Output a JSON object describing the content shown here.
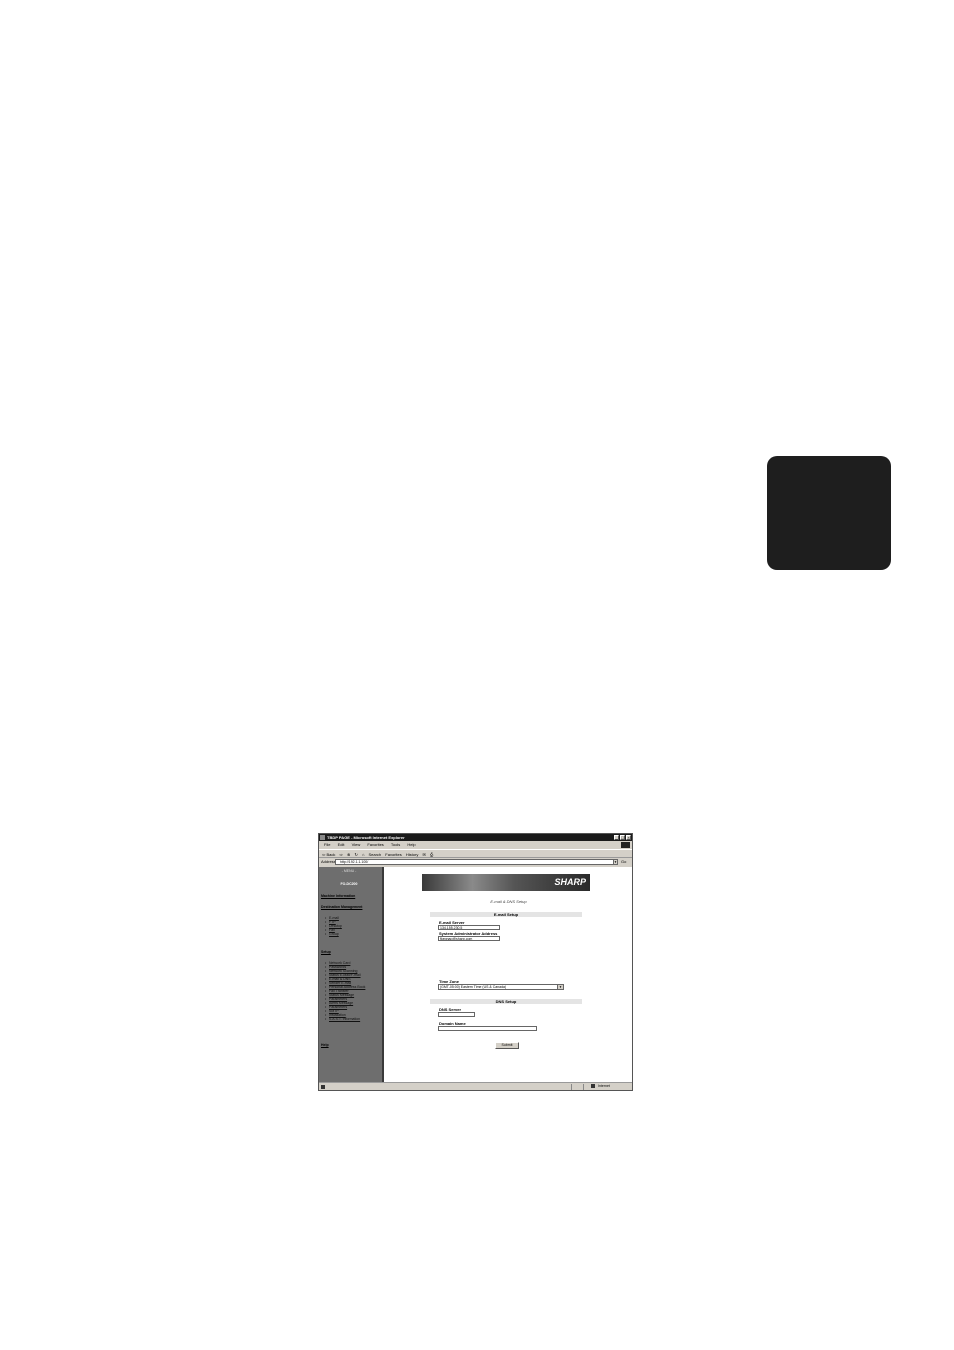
{
  "window": {
    "title": "TBDP PAGE - Microsoft Internet Explorer",
    "controls": [
      "_",
      "□",
      "×"
    ]
  },
  "menubar": {
    "items": [
      "File",
      "Edit",
      "View",
      "Favorites",
      "Tools",
      "Help"
    ]
  },
  "toolbar": {
    "back": "⇦ Back",
    "forward": "⇨",
    "stop": "⊗",
    "refresh": "↻",
    "home": "⌂",
    "search": "Search",
    "favorites": "Favorites",
    "history": "History",
    "mail": "✉",
    "print": "⎙"
  },
  "addressbar": {
    "label": "Address",
    "url": "http://192.1.1.100/",
    "go": "Go"
  },
  "sidebar": {
    "menu_title": "- MENU -",
    "model": "FO-DC200",
    "machine_information": "Machine Information",
    "destination_management": "Destination Management",
    "destination_items": [
      "E-mail",
      "FTP",
      "Desktop",
      "Fax",
      "Group"
    ],
    "setup": "Setup",
    "setup_items": [
      "Network Card",
      "Passwords",
      "Network Scanning",
      "Status E-Mail/F-mail",
      "E-mail & DNS",
      "Sender E-mail",
      "Personal Address Book",
      "Fax Transfer",
      "Status Message",
      "Parameters",
      "Alerts Message",
      "Parameters",
      "SMTP",
      "Installation",
      "S.A.S.T. Information"
    ],
    "help": "Help"
  },
  "main": {
    "banner_logo": "SHARP",
    "page_title": "E-mail & DNS Setup",
    "email_section": "E-mail Setup",
    "email_server_label": "E-mail Server",
    "email_server_value": "134.155.230.5",
    "admin_address_label": "System Administrator Address",
    "admin_address_value": "fkegnap@sharp.com",
    "time_zone_label": "Time Zone",
    "time_zone_value": "(GMT-05:00) Eastern Time (US & Canada)",
    "dns_section": "DNS Setup",
    "dns_server_label": "DNS Server",
    "dns_server_value": "",
    "domain_name_label": "Domain Name",
    "domain_name_value": "",
    "submit_label": "Submit"
  },
  "statusbar": {
    "zone": "Internet"
  }
}
